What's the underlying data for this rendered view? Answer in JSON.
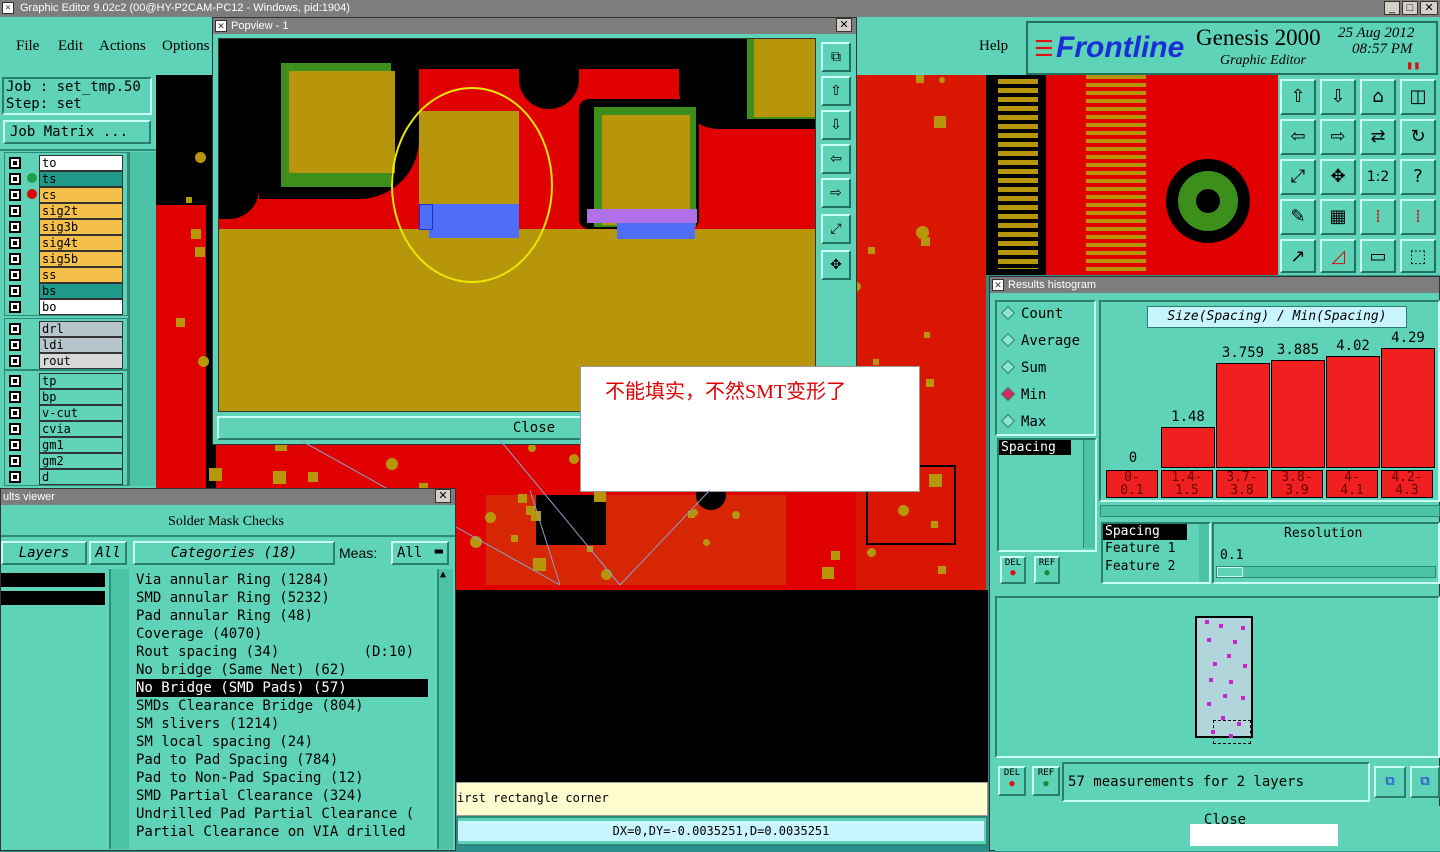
{
  "main_window": {
    "title": "Graphic Editor 9.02c2 (00@HY-P2CAM-PC12 - Windows, pid:1904)",
    "menu": [
      "File",
      "Edit",
      "Actions",
      "Options"
    ],
    "help": "Help",
    "brand": "Frontline",
    "product": "Genesis 2000",
    "subtitle": "Graphic Editor",
    "date": "25 Aug 2012",
    "time": "08:57 PM"
  },
  "job": {
    "job_label": "Job : set_tmp.50",
    "step_label": "Step: set",
    "matrix_button": "Job Matrix ..."
  },
  "layers": {
    "group1": [
      {
        "name": "to",
        "color": "#ffffff"
      },
      {
        "name": "ts",
        "color": "#1f9a8a"
      },
      {
        "name": "cs",
        "color": "#f5c04a"
      },
      {
        "name": "sig2t",
        "color": "#f5c04a"
      },
      {
        "name": "sig3b",
        "color": "#f5c04a"
      },
      {
        "name": "sig4t",
        "color": "#f5c04a"
      },
      {
        "name": "sig5b",
        "color": "#f5c04a"
      },
      {
        "name": "ss",
        "color": "#f5c04a"
      },
      {
        "name": "bs",
        "color": "#1f9a8a"
      },
      {
        "name": "bo",
        "color": "#ffffff"
      }
    ],
    "group2": [
      {
        "name": "drl",
        "color": "#b7c6cc"
      },
      {
        "name": "ldi",
        "color": "#b7c6cc"
      },
      {
        "name": "rout",
        "color": "#d8d8d8"
      }
    ],
    "group3": [
      {
        "name": "tp",
        "color": "#5fd3b7"
      },
      {
        "name": "bp",
        "color": "#5fd3b7"
      },
      {
        "name": "v-cut",
        "color": "#5fd3b7"
      },
      {
        "name": "cvia",
        "color": "#5fd3b7"
      },
      {
        "name": "gm1",
        "color": "#5fd3b7"
      },
      {
        "name": "gm2",
        "color": "#5fd3b7"
      },
      {
        "name": "d",
        "color": "#5fd3b7"
      }
    ]
  },
  "popview": {
    "title": "Popview - 1",
    "close": "Close"
  },
  "annotation": {
    "text": "不能填实，不然SMT变形了"
  },
  "results_viewer": {
    "title": "ults viewer",
    "header": "Solder Mask Checks",
    "layers_tab": "Layers",
    "all_tab": "All",
    "categories_label": "Categories (18)",
    "meas_label": "Meas:",
    "meas_value": "All",
    "categories": [
      "Via annular Ring (1284)",
      "SMD annular Ring (5232)",
      "Pad annular Ring (48)",
      "Coverage (4070)",
      "Rout spacing (34)          (D:10)",
      "No bridge (Same Net) (62)",
      "No Bridge (SMD Pads) (57)",
      "SMDs Clearance Bridge (804)",
      "SM slivers (1214)",
      "SM local spacing (24)",
      "Pad to Pad Spacing (784)",
      "Pad to Non-Pad Spacing (12)",
      "SMD Partial Clearance (324)",
      "Undrilled Pad Partial Clearance (",
      "Partial Clearance on VIA drilled"
    ],
    "selected_index": 6
  },
  "status": {
    "prompt": "irst rectangle corner",
    "coords": "DX=0,DY=-0.0035251,D=0.0035251"
  },
  "histogram": {
    "title": "Results histogram",
    "options": [
      "Count",
      "Average",
      "Sum",
      "Min",
      "Max"
    ],
    "selected_option": "Min",
    "chart_title": "Size(Spacing) / Min(Spacing)",
    "list_item": "Spacing",
    "del": "DEL",
    "ref": "REF",
    "feature_list": [
      "Spacing",
      "Feature 1",
      "Feature 2"
    ],
    "resolution_label": "Resolution",
    "resolution_value": "0.1",
    "measurements": "57 measurements for 2 layers",
    "close": "Close"
  },
  "chart_data": {
    "type": "bar",
    "title": "Size(Spacing) / Min(Spacing)",
    "categories": [
      "0-\n0.1",
      "1.4-\n1.5",
      "3.7-\n3.8",
      "3.8-\n3.9",
      "4-\n4.1",
      "4.2-\n4.3"
    ],
    "values": [
      0,
      1.48,
      3.759,
      3.885,
      4.02,
      4.29
    ],
    "value_labels": [
      "0",
      "1.48",
      "3.759",
      "3.885",
      "4.02",
      "4.29"
    ],
    "ylim": [
      0,
      4.3
    ]
  },
  "colors": {
    "panel": "#5fd3b7",
    "pcb_red": "#e00000",
    "pad_gold": "#b8960c",
    "mask_green": "#3d8f1c",
    "highlight_blue": "#4f6ef7",
    "highlight_purple": "#b070e8"
  }
}
